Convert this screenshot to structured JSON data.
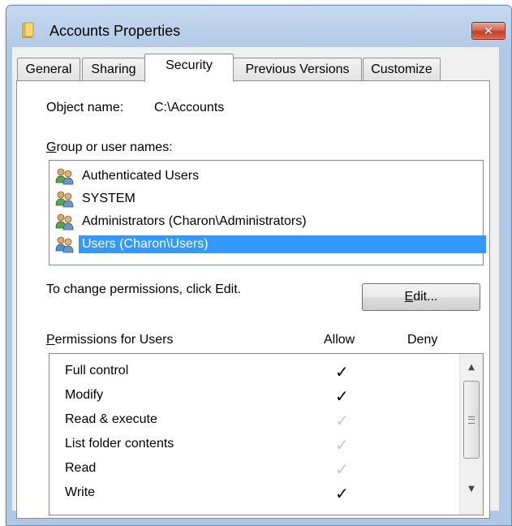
{
  "window": {
    "title": "Accounts Properties",
    "close_label": "✕"
  },
  "tabs": [
    {
      "label": "General"
    },
    {
      "label": "Sharing"
    },
    {
      "label": "Security",
      "active": true
    },
    {
      "label": "Previous Versions"
    },
    {
      "label": "Customize"
    }
  ],
  "security": {
    "object_name_label": "Object name:",
    "object_name_value": "C:\\Accounts",
    "group_label_mnemonic": "G",
    "group_label_rest": "roup or user names:",
    "users": [
      {
        "name": "Authenticated Users",
        "icon": "users-group-icon"
      },
      {
        "name": "SYSTEM",
        "icon": "users-group-icon"
      },
      {
        "name": "Administrators (Charon\\Administrators)",
        "icon": "users-group-icon"
      },
      {
        "name": "Users (Charon\\Users)",
        "icon": "users-group-icon",
        "selected": true
      }
    ],
    "change_hint": "To change permissions, click Edit.",
    "edit_mnemonic": "E",
    "edit_rest": "dit...",
    "perm_label_mnemonic": "P",
    "perm_label_rest": "ermissions for Users",
    "allow_header": "Allow",
    "deny_header": "Deny",
    "check_glyph": "✓",
    "permissions": [
      {
        "name": "Full control",
        "allow": "dark"
      },
      {
        "name": "Modify",
        "allow": "dark"
      },
      {
        "name": "Read & execute",
        "allow": "grey"
      },
      {
        "name": "List folder contents",
        "allow": "grey"
      },
      {
        "name": "Read",
        "allow": "grey"
      },
      {
        "name": "Write",
        "allow": "dark"
      }
    ]
  },
  "colors": {
    "selection": "#3399ff",
    "title_bar": "#b6cde8",
    "close_button": "#c43c21"
  }
}
